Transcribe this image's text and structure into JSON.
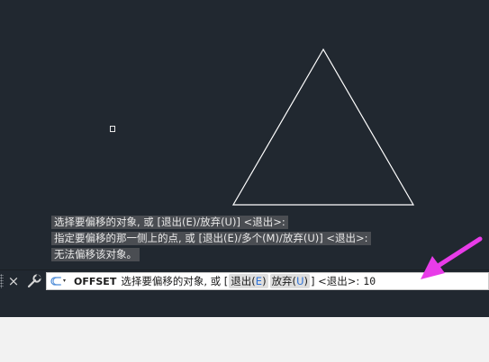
{
  "history": [
    "选择要偏移的对象, 或 [退出(E)/放弃(U)] <退出>:",
    "指定要偏移的那一侧上的点, 或 [退出(E)/多个(M)/放弃(U)] <退出>:",
    "无法偏移该对象。"
  ],
  "cmdline": {
    "close_icon": "×",
    "command_name": "OFFSET",
    "prompt_start": "选择要偏移的对象, 或 [",
    "option_exit_pre": "退出(",
    "option_exit_key": "E",
    "option_exit_post": ")",
    "option_undo_pre": "放弃(",
    "option_undo_key": "U",
    "option_undo_post": ")",
    "prompt_end": "] <退出>:",
    "typed_value": "10"
  },
  "icons": {
    "close": "close-icon",
    "customize": "wrench-icon",
    "recent": "recent-commands-icon",
    "annotation": "arrow-pointer-icon"
  },
  "colors": {
    "canvas_bg": "#212830",
    "triangle_stroke": "#ffffff",
    "history_bg": "#4a4d52",
    "option_key": "#2a6fd6",
    "annotation_arrow": "#e83ce8"
  }
}
